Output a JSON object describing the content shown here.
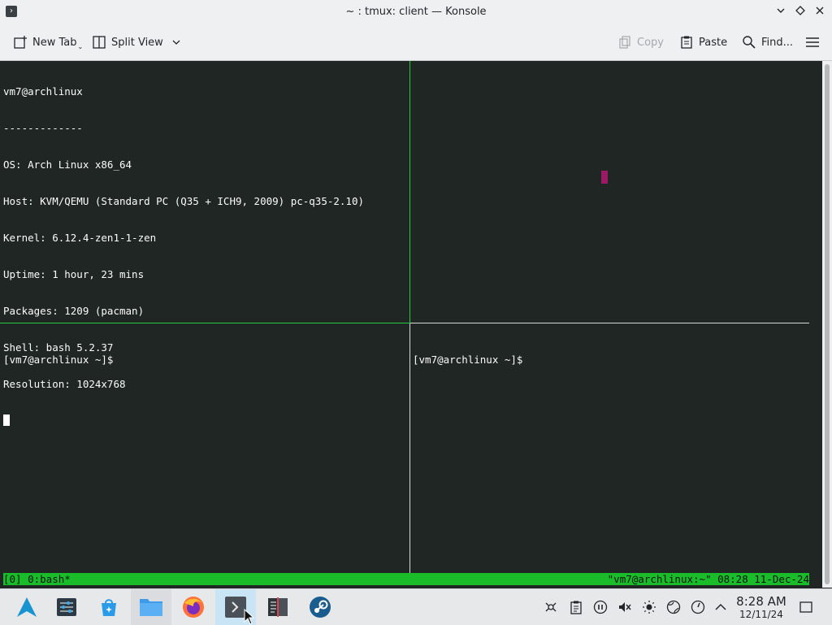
{
  "window": {
    "title": "~ : tmux: client — Konsole"
  },
  "toolbar": {
    "new_tab_label": "New Tab",
    "split_view_label": "Split View",
    "copy_label": "Copy",
    "paste_label": "Paste",
    "find_label": "Find..."
  },
  "panes": {
    "top_left": {
      "lines": [
        "vm7@archlinux",
        "-------------",
        "OS: Arch Linux x86_64",
        "Host: KVM/QEMU (Standard PC (Q35 + ICH9, 2009) pc-q35-2.10)",
        "Kernel: 6.12.4-zen1-1-zen",
        "Uptime: 1 hour, 23 mins",
        "Packages: 1209 (pacman)",
        "Shell: bash 5.2.37",
        "Resolution: 1024x768"
      ]
    },
    "bottom_left": {
      "prompt": "[vm7@archlinux ~]$"
    },
    "bottom_right": {
      "prompt": "[vm7@archlinux ~]$"
    }
  },
  "tmux_status": {
    "left": "[0] 0:bash*",
    "right": "\"vm7@archlinux:~\" 08:28 11-Dec-24"
  },
  "colors": {
    "terminal_bg": "#1f2624",
    "status_green": "#1bbc2a",
    "active_pane_border": "#27c93f",
    "magenta_cursor": "#9c1a63"
  },
  "taskbar": {
    "apps": [
      {
        "name": "app-launcher-icon"
      },
      {
        "name": "system-settings-icon"
      },
      {
        "name": "discover-store-icon"
      },
      {
        "name": "file-manager-icon"
      },
      {
        "name": "firefox-icon"
      },
      {
        "name": "konsole-icon"
      },
      {
        "name": "text-editor-icon"
      },
      {
        "name": "steam-icon"
      }
    ],
    "clock": {
      "time": "8:28 AM",
      "date": "12/11/24"
    }
  }
}
